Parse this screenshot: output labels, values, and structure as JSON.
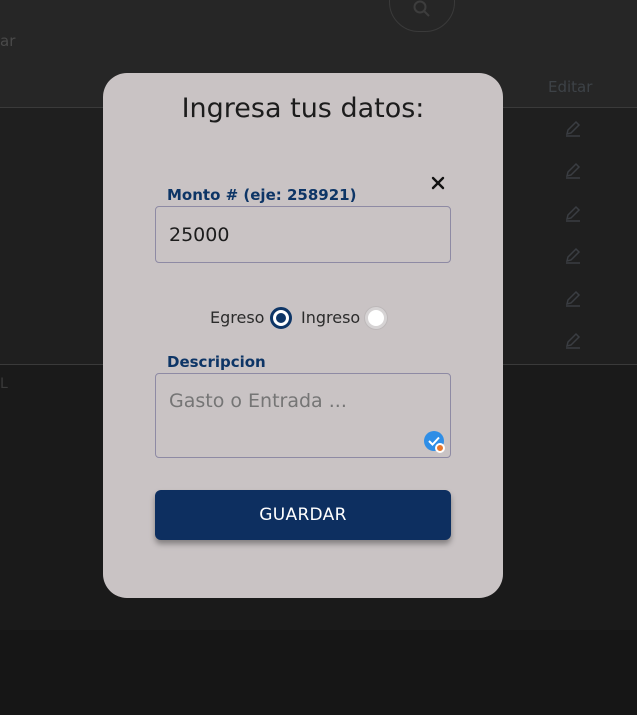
{
  "background": {
    "top_fragment": "ar",
    "edit_column_header": "Editar",
    "edit_rows": [
      "edit-icon",
      "edit-icon",
      "edit-icon",
      "edit-icon",
      "edit-icon",
      "edit-icon"
    ],
    "lower_fragment": "L"
  },
  "modal": {
    "title": "Ingresa tus datos:",
    "close_icon": "close-icon",
    "amount": {
      "label": "Monto # (eje: 258921)",
      "value": "25000"
    },
    "type_options": [
      {
        "label": "Egreso",
        "checked": true
      },
      {
        "label": "Ingreso",
        "checked": false
      }
    ],
    "description": {
      "label": "Descripcion",
      "placeholder": "Gasto o Entrada ...",
      "value": ""
    },
    "save_label": "GUARDAR"
  },
  "colors": {
    "modal_bg": "#c9c3c4",
    "accent": "#0d3566",
    "button_bg": "#0d2f60"
  }
}
